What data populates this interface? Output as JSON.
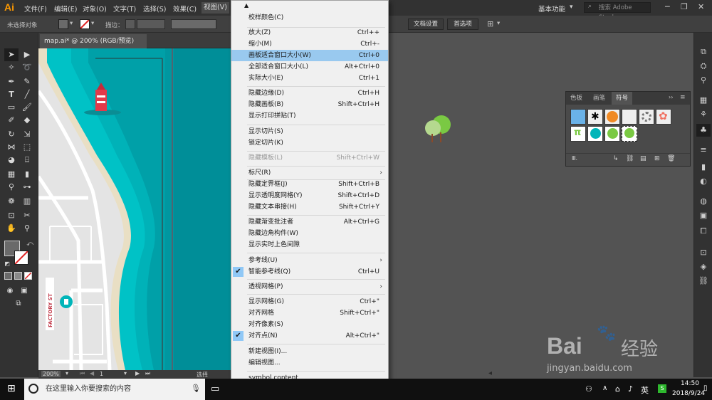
{
  "app": {
    "logo": "Ai"
  },
  "menubar": {
    "items": [
      "文件(F)",
      "编辑(E)",
      "对象(O)",
      "文字(T)",
      "选择(S)",
      "效果(C)",
      "视图(V)"
    ],
    "workspace": "基本功能",
    "stock_search_placeholder": "搜索 Adobe Stock"
  },
  "control_bar": {
    "selection_status": "未选择对象",
    "stroke_label": "描边：",
    "doc_settings": "文档设置",
    "preferences": "首选项"
  },
  "document": {
    "tab_title": "map.ai* @ 200% (RGB/预览)"
  },
  "map": {
    "street_label": "FACTORY ST"
  },
  "status_bar": {
    "zoom": "200%",
    "artboard": "1",
    "tool": "选择"
  },
  "view_menu": {
    "items": [
      {
        "label": "校样颜色(C)",
        "shortcut": ""
      },
      {
        "label": "放大(Z)",
        "shortcut": "Ctrl++"
      },
      {
        "label": "缩小(M)",
        "shortcut": "Ctrl+-"
      },
      {
        "label": "画板适合窗口大小(W)",
        "shortcut": "Ctrl+0"
      },
      {
        "label": "全部适合窗口大小(L)",
        "shortcut": "Alt+Ctrl+0"
      },
      {
        "label": "实际大小(E)",
        "shortcut": "Ctrl+1"
      },
      {
        "label": "隐藏边缘(D)",
        "shortcut": "Ctrl+H"
      },
      {
        "label": "隐藏画板(B)",
        "shortcut": "Shift+Ctrl+H"
      },
      {
        "label": "显示打印拼贴(T)",
        "shortcut": ""
      },
      {
        "label": "显示切片(S)",
        "shortcut": ""
      },
      {
        "label": "锁定切片(K)",
        "shortcut": ""
      },
      {
        "label": "隐藏模板(L)",
        "shortcut": "Shift+Ctrl+W"
      },
      {
        "label": "标尺(R)",
        "shortcut": ""
      },
      {
        "label": "隐藏定界框(J)",
        "shortcut": "Shift+Ctrl+B"
      },
      {
        "label": "显示透明度网格(Y)",
        "shortcut": "Shift+Ctrl+D"
      },
      {
        "label": "隐藏文本串接(H)",
        "shortcut": "Shift+Ctrl+Y"
      },
      {
        "label": "隐藏渐变批注者",
        "shortcut": "Alt+Ctrl+G"
      },
      {
        "label": "隐藏边角构件(W)",
        "shortcut": ""
      },
      {
        "label": "显示实时上色间隙",
        "shortcut": ""
      },
      {
        "label": "参考线(U)",
        "shortcut": ""
      },
      {
        "label": "智能参考线(Q)",
        "shortcut": "Ctrl+U"
      },
      {
        "label": "透视网格(P)",
        "shortcut": ""
      },
      {
        "label": "显示网格(G)",
        "shortcut": "Ctrl+\""
      },
      {
        "label": "对齐网格",
        "shortcut": "Shift+Ctrl+\""
      },
      {
        "label": "对齐像素(S)",
        "shortcut": ""
      },
      {
        "label": "对齐点(N)",
        "shortcut": "Alt+Ctrl+\""
      },
      {
        "label": "新建视图(I)...",
        "shortcut": ""
      },
      {
        "label": "编辑视图...",
        "shortcut": ""
      },
      {
        "label": "symbol content",
        "shortcut": ""
      }
    ]
  },
  "symbols_panel": {
    "tabs": [
      "色板",
      "画笔",
      "符号"
    ],
    "active_tab": "符号"
  },
  "taskbar": {
    "search_placeholder": "在这里输入你要搜索的内容",
    "time": "14:50",
    "date": "2018/9/24"
  },
  "watermark": {
    "brand": "Bai",
    "suffix": "经验",
    "url": "jingyan.baidu.com"
  }
}
